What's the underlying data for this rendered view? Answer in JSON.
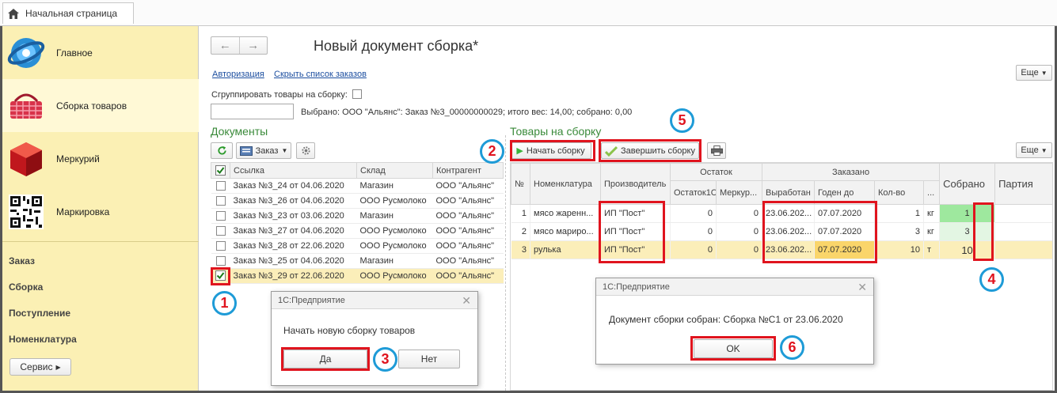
{
  "tabbar": {
    "home_tab": "Начальная страница"
  },
  "sidebar": {
    "sections": [
      {
        "label": "Главное"
      },
      {
        "label": "Сборка товаров"
      },
      {
        "label": "Меркурий"
      },
      {
        "label": "Маркировка"
      }
    ],
    "links": [
      "Заказ",
      "Сборка",
      "Поступление",
      "Номенклатура"
    ],
    "service_button": "Сервис"
  },
  "header": {
    "title": "Новый документ сборка*",
    "link_auth": "Авторизация",
    "link_hide": "Скрыть список заказов",
    "more_label": "Еще",
    "group_label": "Сгруппировать товары на сборку:",
    "selected_text": "Выбрано: ООО \"Альянс\": Заказ №3_00000000029; итого вес: 14,00; собрано: 0,00"
  },
  "documents": {
    "title": "Документы",
    "order_button": "Заказ",
    "columns": [
      "Ссылка",
      "Склад",
      "Контрагент"
    ],
    "rows": [
      {
        "checked": false,
        "ref": "Заказ №3_24 от 04.06.2020",
        "store": "Магазин",
        "contractor": "ООО \"Альянс\""
      },
      {
        "checked": false,
        "ref": "Заказ №3_26 от 04.06.2020",
        "store": "ООО Русмолоко",
        "contractor": "ООО \"Альянс\""
      },
      {
        "checked": false,
        "ref": "Заказ №3_23 от 03.06.2020",
        "store": "Магазин",
        "contractor": "ООО \"Альянс\""
      },
      {
        "checked": false,
        "ref": "Заказ №3_27 от 04.06.2020",
        "store": "ООО Русмолоко",
        "contractor": "ООО \"Альянс\""
      },
      {
        "checked": false,
        "ref": "Заказ №3_28 от 22.06.2020",
        "store": "ООО Русмолоко",
        "contractor": "ООО \"Альянс\""
      },
      {
        "checked": false,
        "ref": "Заказ №3_25 от 04.06.2020",
        "store": "Магазин",
        "contractor": "ООО \"Альянс\""
      },
      {
        "checked": true,
        "ref": "Заказ №3_29 от 22.06.2020",
        "store": "ООО Русмолоко",
        "contractor": "ООО \"Альянс\""
      }
    ]
  },
  "goods": {
    "title": "Товары на сборку",
    "start_button": "Начать сборку",
    "finish_button": "Завершить сборку",
    "more_label": "Еще",
    "columns": {
      "num": "№",
      "nomenclature": "Номенклатура",
      "producer": "Производитель",
      "stock": "Остаток",
      "ordered": "Заказано",
      "collected": "Собрано",
      "batch": "Партия",
      "stock1c": "Остаток1С",
      "mercury": "Меркур...",
      "produced": "Выработан",
      "valid_until": "Годен до",
      "qty": "Кол-во",
      "dots": "..."
    },
    "rows": [
      {
        "num": "1",
        "name": "мясо жаренн...",
        "producer": "ИП \"Пост\"",
        "stock1c": "0",
        "mercury": "0",
        "produced": "23.06.202...",
        "valid": "07.07.2020",
        "qty": "1",
        "unit": "кг",
        "collected": "1"
      },
      {
        "num": "2",
        "name": "мясо мариро...",
        "producer": "ИП \"Пост\"",
        "stock1c": "0",
        "mercury": "0",
        "produced": "23.06.202...",
        "valid": "07.07.2020",
        "qty": "3",
        "unit": "кг",
        "collected": "3"
      },
      {
        "num": "3",
        "name": "рулька",
        "producer": "ИП \"Пост\"",
        "stock1c": "0",
        "mercury": "0",
        "produced": "23.06.202...",
        "valid": "07.07.2020",
        "qty": "10",
        "unit": "т",
        "collected": "10"
      }
    ]
  },
  "dialog_start": {
    "title": "1С:Предприятие",
    "message": "Начать новую сборку товаров",
    "yes": "Да",
    "no": "Нет"
  },
  "dialog_done": {
    "title": "1С:Предприятие",
    "message": "Документ сборки собран: Сборка №С1 от 23.06.2020",
    "ok": "OK"
  },
  "steps": [
    "1",
    "2",
    "3",
    "4",
    "5",
    "6"
  ],
  "colors": {
    "accent_red": "#e0141e",
    "badge_blue": "#1e9bd7",
    "sidebar_bg": "#fbf0b4",
    "section_green": "#3a8a3a"
  }
}
